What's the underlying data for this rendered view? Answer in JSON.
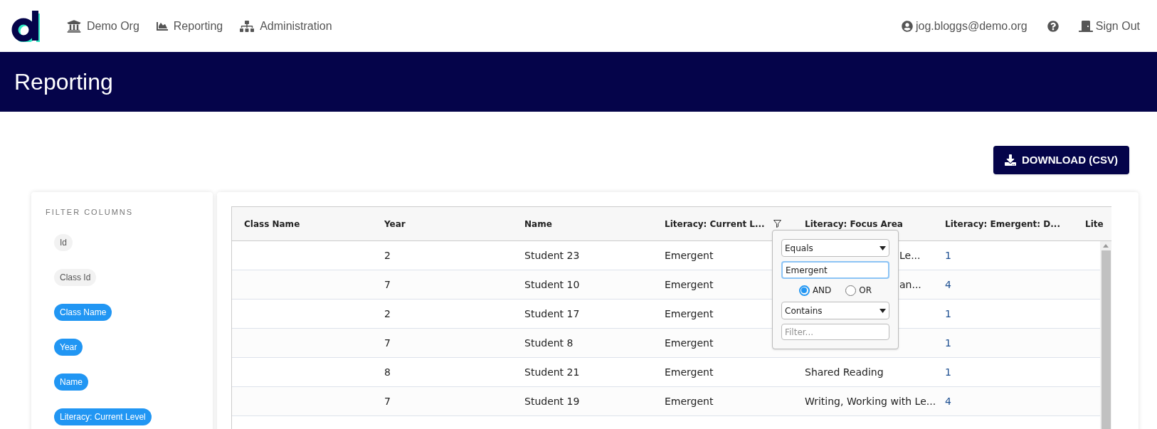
{
  "nav": {
    "links": [
      {
        "kind": "org",
        "label": "Demo Org"
      },
      {
        "kind": "chart",
        "label": "Reporting"
      },
      {
        "kind": "admin",
        "label": "Administration"
      }
    ],
    "right": [
      {
        "kind": "user",
        "label": "jog.bloggs@demo.org"
      },
      {
        "kind": "help"
      },
      {
        "kind": "signout",
        "label": "Sign Out"
      }
    ]
  },
  "page_title": "Reporting",
  "download_button": "DOWNLOAD (CSV)",
  "filter_columns": {
    "title": "FILTER COLUMNS",
    "chips": [
      {
        "label": "Id",
        "selected": false
      },
      {
        "label": "Class Id",
        "selected": false
      },
      {
        "label": "Class Name",
        "selected": true
      },
      {
        "label": "Year",
        "selected": true
      },
      {
        "label": "Name",
        "selected": true
      },
      {
        "label": "Literacy: Current Level",
        "selected": true
      }
    ]
  },
  "table": {
    "columns": [
      {
        "label": "Class Name",
        "filter": false
      },
      {
        "label": "Year",
        "filter": false
      },
      {
        "label": "Name",
        "filter": false
      },
      {
        "label": "Literacy: Current L...",
        "filter": true
      },
      {
        "label": "Literacy: Focus Area",
        "filter": false
      },
      {
        "label": "Literacy: Emergent: D...",
        "filter": false
      },
      {
        "label": "Lite",
        "filter": false
      }
    ],
    "rows": [
      {
        "cells": [
          "",
          "2",
          "Student 23",
          "Emergent",
          {
            "text": "Le...",
            "covered": true
          },
          "1",
          ""
        ]
      },
      {
        "cells": [
          "",
          "7",
          "Student 10",
          "Emergent",
          {
            "text": "an...",
            "covered": true
          },
          "4",
          ""
        ]
      },
      {
        "cells": [
          "",
          "2",
          "Student 17",
          "Emergent",
          "",
          "1",
          ""
        ]
      },
      {
        "cells": [
          "",
          "7",
          "Student 8",
          "Emergent",
          "",
          "1",
          ""
        ]
      },
      {
        "cells": [
          "",
          "8",
          "Student 21",
          "Emergent",
          "Shared Reading",
          "1",
          ""
        ]
      },
      {
        "cells": [
          "",
          "7",
          "Student 19",
          "Emergent",
          "Writing, Working with Le...",
          "4",
          ""
        ]
      }
    ]
  },
  "filter_popup": {
    "operator_1": "Equals",
    "value_1": "Emergent",
    "join": [
      {
        "label": "AND",
        "selected": true
      },
      {
        "label": "OR",
        "selected": false
      }
    ],
    "operator_2": "Contains",
    "placeholder": "Filter..."
  }
}
